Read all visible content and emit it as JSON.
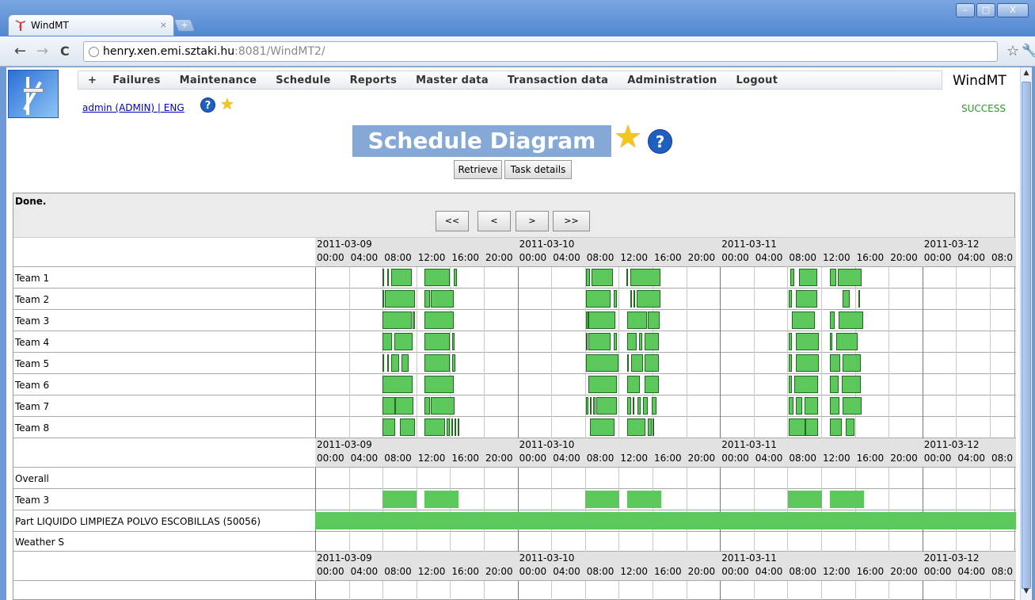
{
  "browser": {
    "tab_title": "WindMT",
    "tab_close": "×",
    "new_tab": "+",
    "url_host": "henry.xen.emi.sztaki.hu",
    "url_rest": ":8081/WindMT2/",
    "back": "←",
    "forward": "→",
    "reload": "C",
    "minimize": "–",
    "maximize": "□",
    "close": "X"
  },
  "app": {
    "brand": "WindMT",
    "status": "SUCCESS",
    "user_link": "admin (ADMIN) | ENG",
    "menu": [
      "+",
      "Failures",
      "Maintenance",
      "Schedule",
      "Reports",
      "Master data",
      "Transaction data",
      "Administration",
      "Logout"
    ],
    "page_title": "Schedule Diagram",
    "buttons": {
      "retrieve": "Retrieve",
      "task_details": "Task details"
    },
    "help": "?",
    "status_text": "Done.",
    "nav": {
      "first": "<<",
      "prev": "<",
      "next": ">",
      "last": ">>"
    }
  },
  "diagram": {
    "days": [
      "2011-03-09",
      "2011-03-10",
      "2011-03-11",
      "2011-03-12"
    ],
    "times": [
      "00:00",
      "04:00",
      "08:00",
      "12:00",
      "16:00",
      "20:00"
    ],
    "last_partial_time": "08:0",
    "teams": [
      "Team 1",
      "Team 2",
      "Team 3",
      "Team 4",
      "Team 5",
      "Team 6",
      "Team 7",
      "Team 8"
    ],
    "summary_rows": [
      "Overall",
      "Team 3",
      "Part LIQUIDO LIMPIEZA POLVO ESCOBILLAS (50056)",
      "Weather S"
    ]
  },
  "colors": {
    "task_green": "#5cc85c",
    "title_bg": "#86a8d6",
    "success": "#2b9a2b"
  }
}
